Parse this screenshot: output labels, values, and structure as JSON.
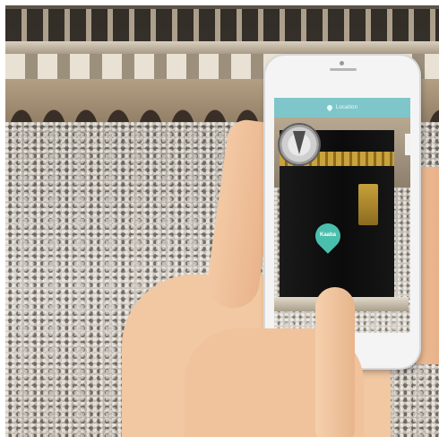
{
  "app": {
    "header_title": "Location",
    "marker_label": "Kaaba"
  },
  "icons": {
    "header": "location-pin-icon",
    "compass": "compass-icon",
    "marker": "map-marker-icon"
  },
  "colors": {
    "app_accent": "#78c8cd",
    "marker": "#4bbfae"
  }
}
